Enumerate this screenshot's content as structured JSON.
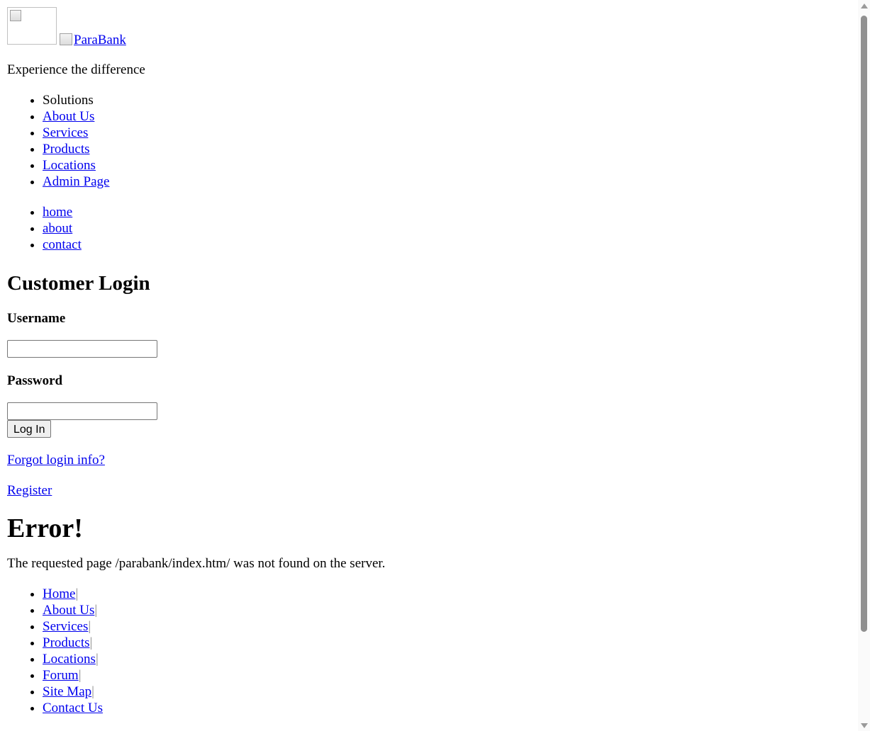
{
  "header": {
    "logo_alt": "ParaBank",
    "tagline": "Experience the difference"
  },
  "solutions_menu": {
    "title": "Solutions",
    "items": [
      "About Us",
      "Services",
      "Products",
      "Locations",
      "Admin Page"
    ]
  },
  "top_nav": {
    "items": [
      "home",
      "about",
      "contact"
    ]
  },
  "login": {
    "title": "Customer Login",
    "username_label": "Username",
    "username_value": "",
    "password_label": "Password",
    "password_value": "",
    "login_button": "Log In",
    "forgot_link": "Forgot login info?",
    "register_link": "Register"
  },
  "error": {
    "title": "Error!",
    "message": "The requested page /parabank/index.htm/ was not found on the server."
  },
  "footer": {
    "items": [
      "Home",
      "About Us",
      "Services",
      "Products",
      "Locations",
      "Forum",
      "Site Map",
      "Contact Us"
    ],
    "separator": "|"
  }
}
